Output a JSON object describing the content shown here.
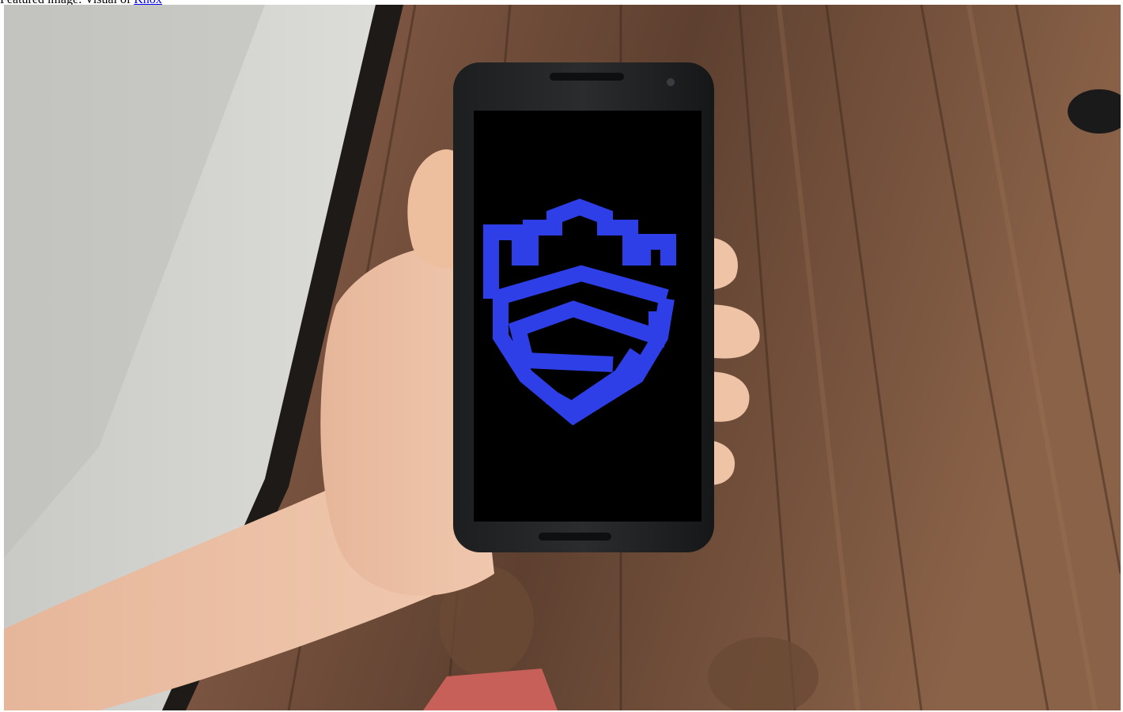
{
  "caption": {
    "text": "Featured image: Visual of ",
    "link_text": "Knox"
  },
  "photo": {
    "subject": "hand-holding-smartphone",
    "screen_logo_icon": "samsung-knox-shield-icon",
    "logo_color": "#2f3fe8",
    "floor_color": "#6b4a33",
    "wall_color": "#d6d6d2"
  }
}
